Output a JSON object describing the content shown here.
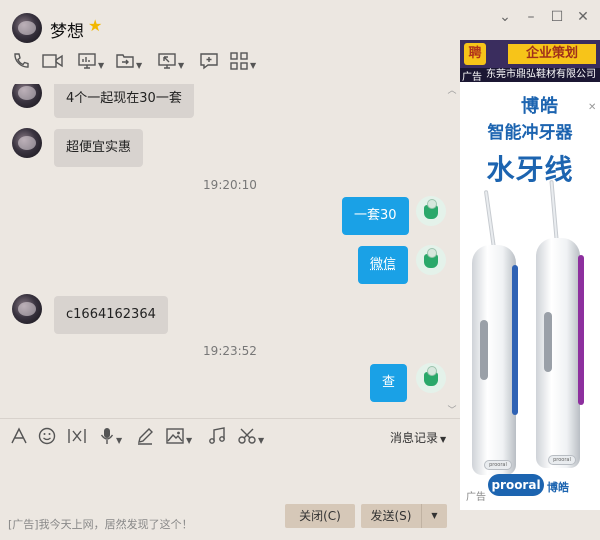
{
  "title_bar": {
    "contact_name": "梦想",
    "star_icon": "star-badge-icon",
    "controls": [
      "chevron-down-icon",
      "minimize-icon",
      "maximize-icon",
      "close-icon"
    ]
  },
  "toolbar": {
    "icons": [
      "phone-icon",
      "video-camera-icon",
      "screen-share-icon",
      "file-transfer-icon",
      "remote-assist-icon",
      "message-box-icon",
      "apps-grid-icon"
    ]
  },
  "messages": [
    {
      "side": "in",
      "text": "4个一起现在30一套"
    },
    {
      "side": "in",
      "text": "超便宜实惠"
    },
    {
      "type": "time",
      "text": "19:20:10"
    },
    {
      "side": "out",
      "text": "一套30"
    },
    {
      "side": "out",
      "text": "微信"
    },
    {
      "side": "in",
      "text": "c1664162364"
    },
    {
      "type": "time",
      "text": "19:23:52"
    },
    {
      "side": "out",
      "text": "查"
    }
  ],
  "input_toolbar": {
    "icons": [
      "font-icon",
      "emoji-icon",
      "gif-icon",
      "voice-icon",
      "handwrite-icon",
      "image-icon",
      "music-icon",
      "screenshot-scissors-icon"
    ],
    "history_label": "消息记录"
  },
  "input": {
    "ad_text": "[广告]我今天上网，居然发现了这个！"
  },
  "buttons": {
    "close": "关闭(C)",
    "send": "发送(S)"
  },
  "ad": {
    "top_badge": "聘",
    "top_label": "企业策划",
    "guang_top": "广告",
    "company": "东莞市鼎弘鞋材有限公司",
    "brand": "博皓",
    "product": "智能冲牙器",
    "headline": "水牙线",
    "foot_guang": "广告",
    "foot_logo": "prooral",
    "foot_brand": "博皓"
  },
  "colors": {
    "bubble_out": "#1aa1e6",
    "bubble_in": "#d8d3cf",
    "ad_blue": "#1c64b0",
    "ad_top": "#3a2d5e",
    "ad_yellow": "#f7c419"
  }
}
